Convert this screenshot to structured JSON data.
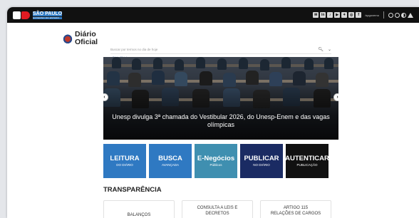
{
  "topbar": {
    "logo_title": "SÃO PAULO",
    "logo_subtitle": "GOVERNO DO ESTADO",
    "social_icons": [
      "email-icon",
      "linkedin-icon",
      "tiktok-icon",
      "youtube-icon",
      "twitter-icon",
      "instagram-icon",
      "facebook-icon"
    ],
    "social_handle": "/spgoverno",
    "accessibility_icons": [
      "contrast-icon",
      "contrast-icon",
      "half-contrast-icon",
      "alert-icon"
    ]
  },
  "header": {
    "brand_line1": "Diário",
    "brand_line2": "Oficial",
    "search_placeholder": "Buscar por termos no dia de hoje",
    "breadcrumb": "Diário Oficial"
  },
  "hero": {
    "caption": "Unesp divulga 3ª chamada do Vestibular 2026, do Unesp-Enem e das vagas olímpicas",
    "prev": "‹",
    "next": "›"
  },
  "tiles": [
    {
      "big": "LEITURA",
      "small": "DO DIÁRIO"
    },
    {
      "big": "BUSCA",
      "small": "AVANÇADA"
    },
    {
      "big": "E-Negócios",
      "small": "Públicos"
    },
    {
      "big": "PUBLICAR",
      "small": "NO DIÁRIO"
    },
    {
      "big": "AUTENTICAR",
      "small": "PUBLICAÇÃO"
    }
  ],
  "transparencia": {
    "title": "TRANSPARÊNCIA",
    "cards": [
      {
        "line1": "BALANÇOS",
        "line2": ""
      },
      {
        "line1": "CONSULTA A LEIS E",
        "line2": "DECRETOS"
      },
      {
        "line1": "ARTIGO 115",
        "line2": "RELAÇÕES DE CARGOS"
      }
    ]
  },
  "colors": {
    "topbar": "#111111",
    "tile_blue": "#2f79c2",
    "tile_teal": "#3f8fb0",
    "tile_navy": "#1a2b63",
    "tile_black": "#111111",
    "brand_red": "#e11b22"
  }
}
